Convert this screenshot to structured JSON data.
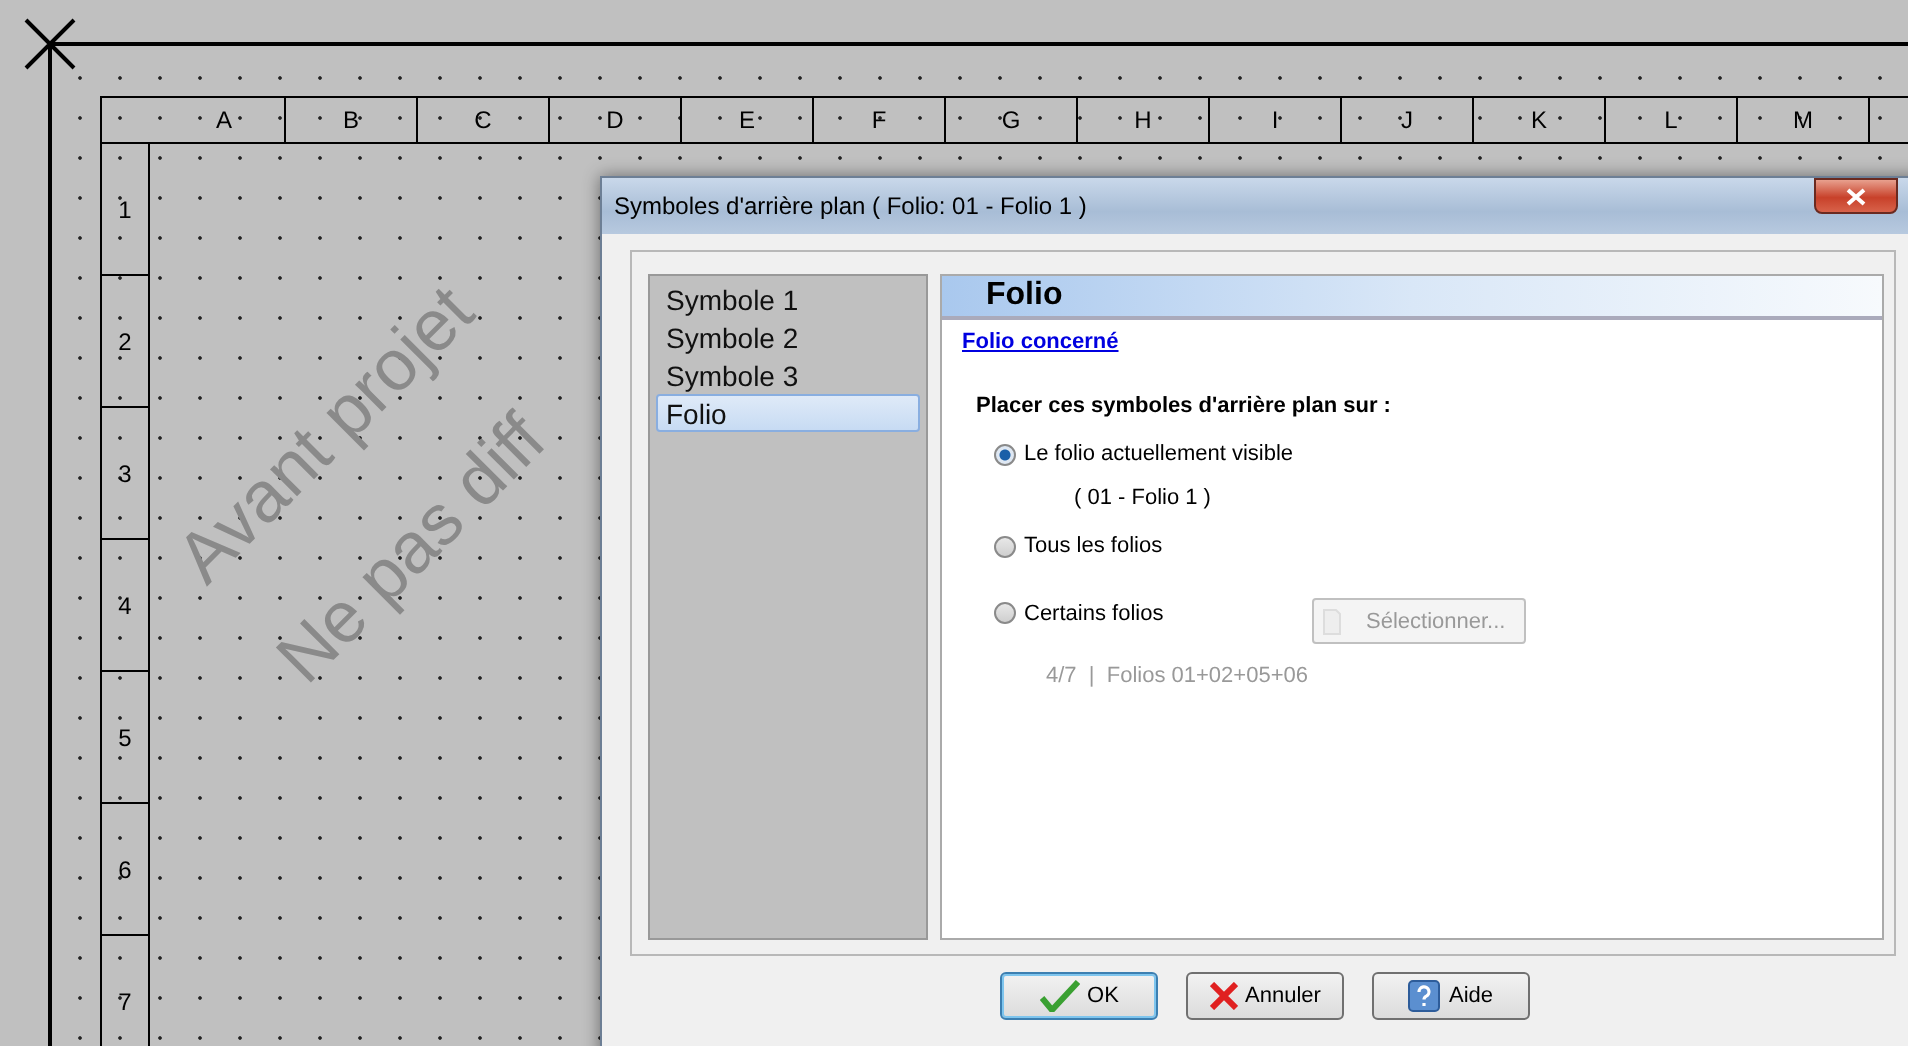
{
  "canvas": {
    "columns": [
      "A",
      "B",
      "C",
      "D",
      "E",
      "F",
      "G",
      "H",
      "I",
      "J",
      "K",
      "L",
      "M"
    ],
    "rows": [
      "1",
      "2",
      "3",
      "4",
      "5",
      "6",
      "7"
    ],
    "stamp": [
      "Avant projet",
      "Ne pas diff"
    ]
  },
  "dialog": {
    "title": "Symboles d'arrière plan ( Folio: 01 - Folio 1 )",
    "sidebar": {
      "items": [
        {
          "label": "Symbole 1",
          "selected": false
        },
        {
          "label": "Symbole 2",
          "selected": false
        },
        {
          "label": "Symbole 3",
          "selected": false
        },
        {
          "label": "Folio",
          "selected": true
        }
      ]
    },
    "panel": {
      "heading": "Folio",
      "link": "Folio concerné",
      "question": "Placer ces symboles d'arrière plan sur :",
      "options": [
        {
          "label": "Le folio actuellement visible",
          "selected": true,
          "detail": "( 01 - Folio 1 )"
        },
        {
          "label": "Tous les folios",
          "selected": false
        },
        {
          "label": "Certains folios",
          "selected": false,
          "detail": "4/7  |  Folios 01+02+05+06",
          "button": {
            "label": "Sélectionner...",
            "disabled": true
          }
        }
      ]
    },
    "buttons": [
      {
        "kind": "ok",
        "label": "OK"
      },
      {
        "kind": "cancel",
        "label": "Annuler"
      },
      {
        "kind": "help",
        "label": "Aide"
      }
    ]
  }
}
